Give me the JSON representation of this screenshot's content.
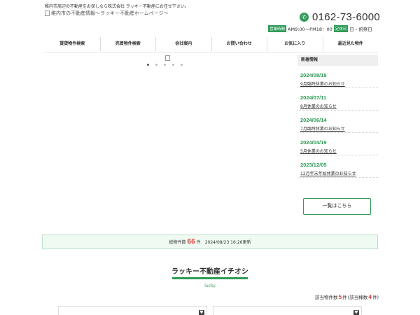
{
  "header": {
    "tagline": "稚内市周辺の不動産をお探しなら株式会社 ラッキー不動産にお任せ下さい。",
    "logo_alt": "稚内市の不動産情報～ラッキー不動産ホームページ～",
    "phone": "0162-73-6000",
    "hours_label": "営業時間",
    "hours": "AM9:00～PM18：00",
    "holiday_label": "定休日",
    "holiday": "日・祝祭日"
  },
  "nav": {
    "items": [
      {
        "label": "賃貸物件検索"
      },
      {
        "label": "売買物件検索"
      },
      {
        "label": "会社案内"
      },
      {
        "label": "お問い合わせ"
      },
      {
        "label": "お気に入り"
      },
      {
        "label": "最近見た物件"
      }
    ]
  },
  "slider": {
    "dot_count": 5,
    "active_dot": 1
  },
  "news": {
    "title": "新着情報",
    "items": [
      {
        "date": "2024/08/19",
        "text": "9月臨時休業のお知らせ"
      },
      {
        "date": "2024/07/11",
        "text": "8月休業のお知らせ"
      },
      {
        "date": "2024/06/14",
        "text": "7月臨時休業のお知らせ"
      },
      {
        "date": "2024/04/19",
        "text": "5月休業のお知らせ"
      },
      {
        "date": "2023/12/05",
        "text": "12月年末年始休業のお知らせ"
      }
    ],
    "more_label": "一覧はこちら"
  },
  "stats": {
    "total_label": "総物件数",
    "total": "66",
    "unit": "件",
    "updated": "2024/08/23 16:26更新"
  },
  "section": {
    "title": "ラッキー不動産イチオシ",
    "subtitle": "lucky",
    "count_label": "該当物件数",
    "count": "5",
    "count_unit": "件",
    "building_note": "(該当棟数",
    "building_count": "4",
    "building_unit": "件)"
  },
  "colors": {
    "accent": "#2e9b57",
    "highlight": "#d9433b"
  }
}
